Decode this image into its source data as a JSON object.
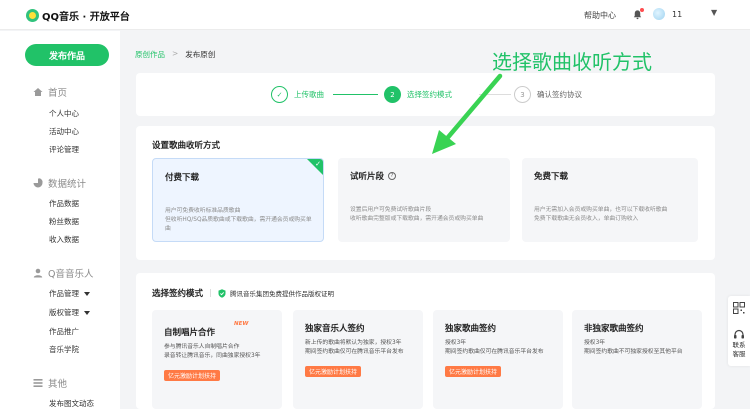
{
  "header": {
    "logo_text": "QQ音乐 · 开放平台",
    "help": "帮助中心",
    "user_name": "11",
    "caret": "▼"
  },
  "sidebar": {
    "publish_button": "发布作品",
    "sections": [
      {
        "label": "首页",
        "icon": "home-icon",
        "items": [
          {
            "label": "个人中心"
          },
          {
            "label": "活动中心"
          },
          {
            "label": "评论管理"
          }
        ]
      },
      {
        "label": "数据统计",
        "icon": "pie-chart-icon",
        "items": [
          {
            "label": "作品数据"
          },
          {
            "label": "粉丝数据"
          },
          {
            "label": "收入数据"
          }
        ]
      },
      {
        "label": "Q音音乐人",
        "icon": "person-icon",
        "items": [
          {
            "label": "作品管理"
          },
          {
            "label": "版权管理"
          },
          {
            "label": "作品推广"
          },
          {
            "label": "音乐学院"
          }
        ]
      },
      {
        "label": "其他",
        "icon": "list-icon",
        "items": [
          {
            "label": "发布图文动态"
          }
        ]
      }
    ]
  },
  "breadcrumb": {
    "parent": "原创作品",
    "separator": ">",
    "current": "发布原创"
  },
  "steps": [
    {
      "number": "1",
      "label": "上传歌曲",
      "status": "done"
    },
    {
      "number": "2",
      "label": "选择签约模式",
      "status": "active"
    },
    {
      "number": "3",
      "label": "确认签约协议",
      "status": "pending"
    }
  ],
  "annotation": "选择歌曲收听方式",
  "listen": {
    "title": "设置歌曲收听方式",
    "options": [
      {
        "title": "付费下载",
        "desc": "用户可免费收听标准品质歌曲\n但收听HQ/SQ品质歌曲或下载歌曲，需开通会员或购买单曲",
        "selected": true
      },
      {
        "title": "试听片段",
        "desc": "设置后用户可免费试听歌曲片段\n收听歌曲完整版或下载歌曲，需开通会员或购买单曲",
        "selected": false
      },
      {
        "title": "免费下载",
        "desc": "用户无需加入会员或购买单曲，也可以下载收听歌曲\n免费下载歌曲无会员收入，单曲订购收入",
        "selected": false
      }
    ]
  },
  "sign": {
    "title": "选择签约模式",
    "subtitle": "腾讯音乐集团免费提供作品版权证明",
    "cards": [
      {
        "title": "自制唱片合作",
        "badge": "NEW",
        "desc": "参与腾讯音乐人自制唱片合作\n录音转让腾讯音乐，同曲独家授权3年",
        "promo": "亿元激励计划扶持"
      },
      {
        "title": "独家音乐人签约",
        "desc": "新上传的歌曲将默认为独家，授权3年\n期间签约歌曲仅可在腾讯音乐平台发布",
        "promo": "亿元激励计划扶持"
      },
      {
        "title": "独家歌曲签约",
        "desc": "授权3年\n期间签约歌曲仅可在腾讯音乐平台发布",
        "promo": "亿元激励计划扶持"
      },
      {
        "title": "非独家歌曲签约",
        "desc": "授权3年\n期间签约歌曲不可独家授权至其他平台"
      }
    ]
  },
  "side_tools": {
    "contact": "联系客服"
  },
  "colors": {
    "accent": "#21c268",
    "promo": "#ff7a45",
    "selected_bg": "#eef5ff"
  }
}
